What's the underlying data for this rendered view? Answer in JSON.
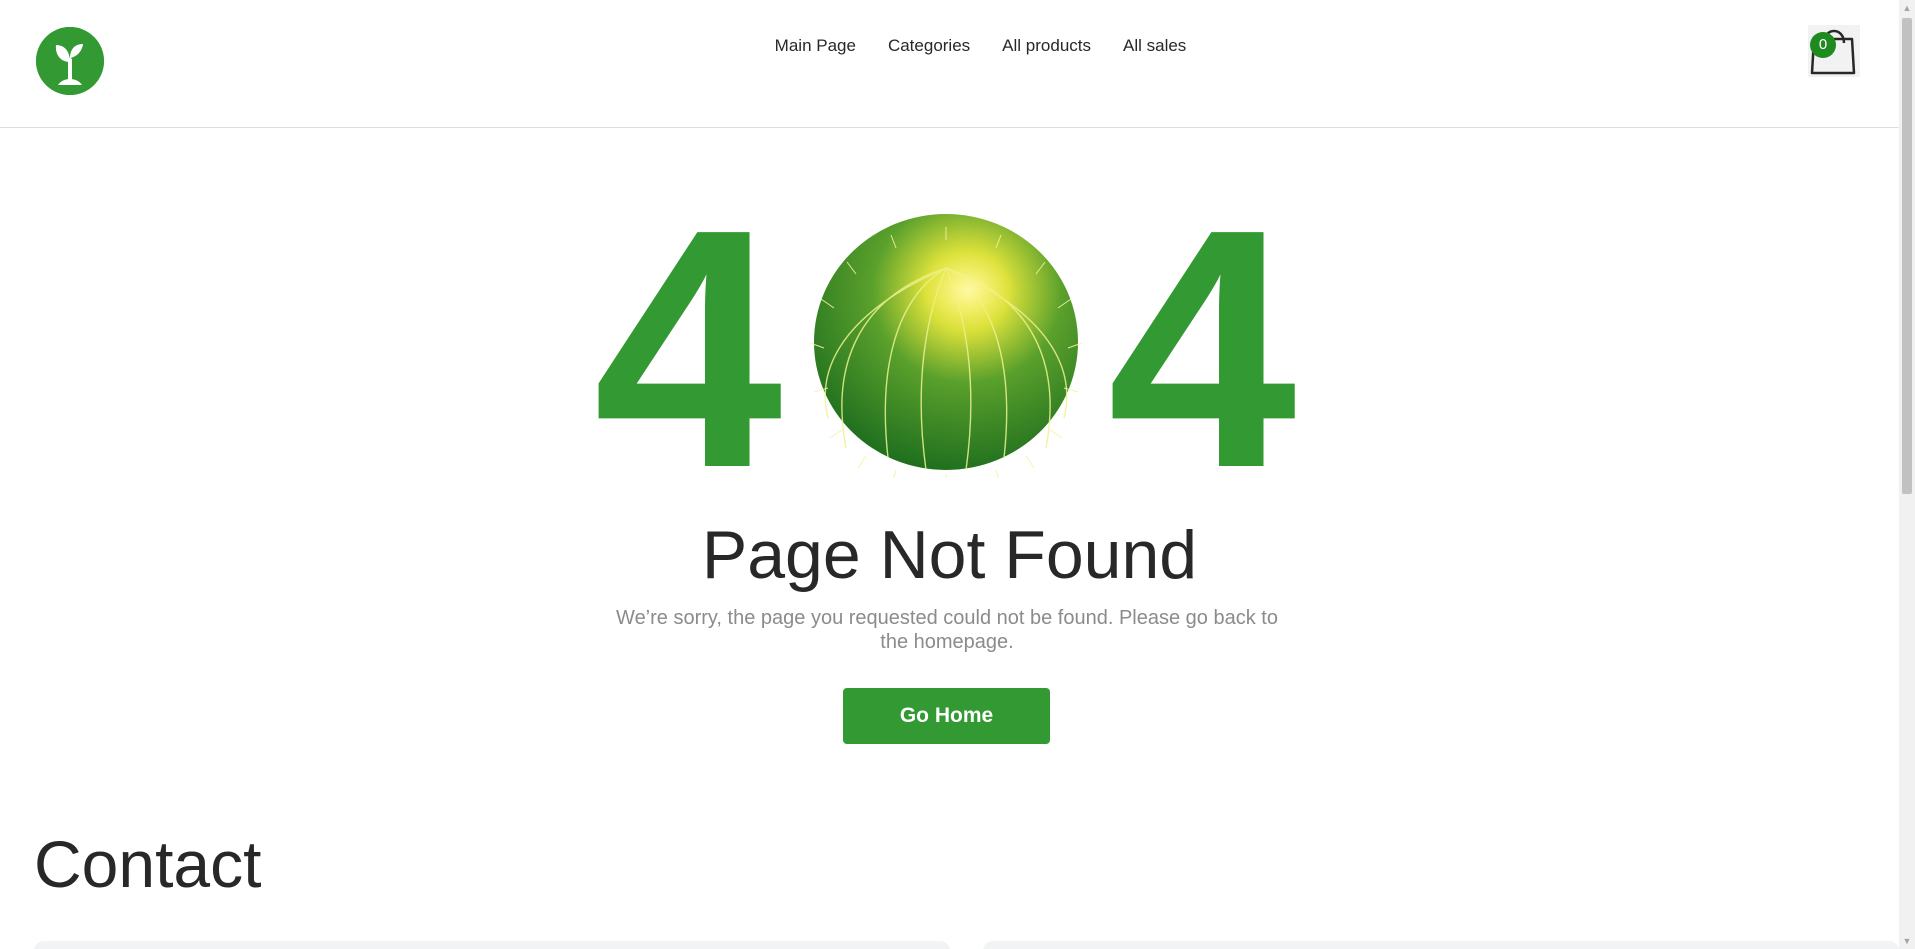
{
  "header": {
    "logo_icon": "sprout-icon",
    "nav": [
      {
        "label": "Main Page"
      },
      {
        "label": "Categories"
      },
      {
        "label": "All products"
      },
      {
        "label": "All sales"
      }
    ],
    "cart_icon": "shopping-bag-icon",
    "cart_count": "0"
  },
  "not_found": {
    "code_left": "4",
    "code_right": "4",
    "code_middle_image": "cactus-ball",
    "title": "Page Not Found",
    "message": "We’re sorry, the page you requested could not be found. Please go back to the homepage.",
    "button_label": "Go Home"
  },
  "contact": {
    "heading": "Contact"
  },
  "colors": {
    "brand_green": "#339933",
    "badge_green": "#1f8a1f",
    "text_dark": "#282828",
    "text_muted": "#8b8b8b"
  }
}
